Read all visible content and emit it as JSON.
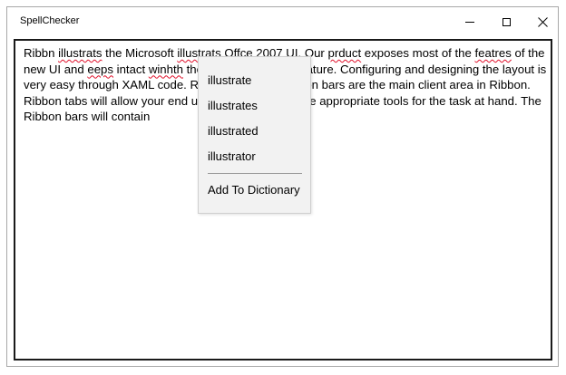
{
  "window": {
    "title": "SpellChecker"
  },
  "editor": {
    "segments": [
      {
        "t": "Ribbn ",
        "err": false
      },
      {
        "t": "illustrats",
        "err": true
      },
      {
        "t": " the Microsoft ",
        "err": false
      },
      {
        "t": "illustrats",
        "err": true
      },
      {
        "t": " Offce 2007 UI. Our ",
        "err": false
      },
      {
        "t": "prduct",
        "err": true
      },
      {
        "t": " exposes most of the ",
        "err": false
      },
      {
        "t": "featres",
        "err": true
      },
      {
        "t": " of the new UI and ",
        "err": false
      },
      {
        "t": "eeps",
        "err": true
      },
      {
        "t": " intact ",
        "err": false
      },
      {
        "t": "winhth",
        "err": true
      },
      {
        "t": " the functionality and feature. Configuring and designing the layout is very easy through XAML code. Ribbon tabs and Ribbon bars are the main client area in Ribbon. Ribbon tabs will allow your end users to quickly find the appropriate tools for the task at hand. The Ribbon bars will contain",
        "err": false
      }
    ]
  },
  "context_menu": {
    "suggestions": [
      "illustrate",
      "illustrates",
      "illustrated",
      "illustrator"
    ],
    "add_to_dictionary": "Add To Dictionary"
  }
}
